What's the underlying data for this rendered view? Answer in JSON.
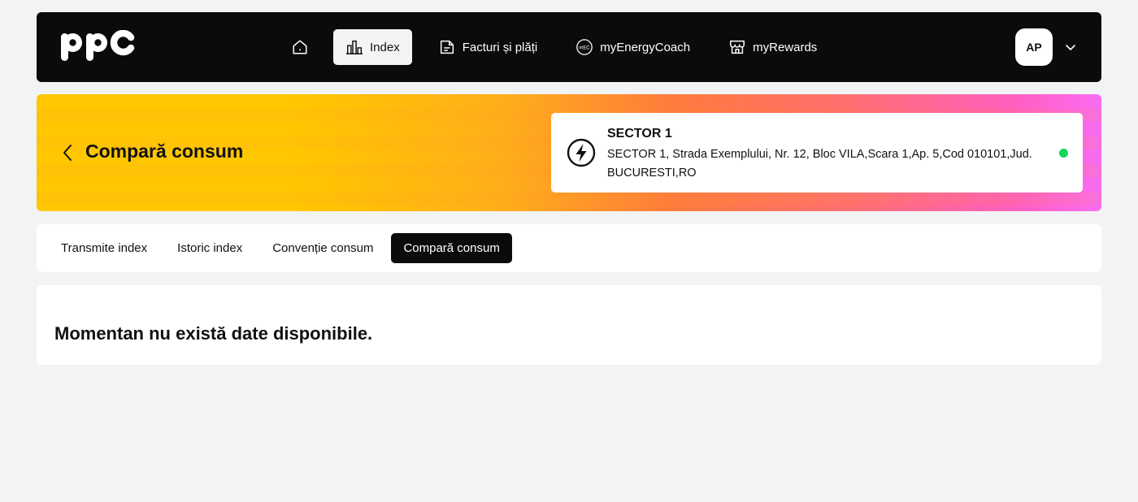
{
  "brand": {
    "logo_text": "ppc"
  },
  "nav": {
    "home_icon": "home-icon",
    "items": [
      {
        "label": "Index",
        "icon": "bar-chart-icon",
        "active": true
      },
      {
        "label": "Facturi și plăți",
        "icon": "invoice-icon",
        "active": false
      },
      {
        "label": "myEnergyCoach",
        "icon": "energy-coach-icon",
        "icon_text": "mEC",
        "active": false
      },
      {
        "label": "myRewards",
        "icon": "rewards-store-icon",
        "active": false
      }
    ]
  },
  "user": {
    "initials": "AP",
    "menu_icon": "chevron-down-icon"
  },
  "hero": {
    "title": "Compară consum",
    "back_icon": "chevron-left-icon",
    "place": {
      "name": "SECTOR 1",
      "address": "SECTOR 1, Strada Exemplului, Nr. 12, Bloc VILA,Scara 1,Ap. 5,Cod 010101,Jud. BUCURESTI,RO",
      "icon": "lightning-bolt-icon",
      "status_color": "#17d65b"
    }
  },
  "tabs": [
    {
      "label": "Transmite index",
      "active": false
    },
    {
      "label": "Istoric index",
      "active": false
    },
    {
      "label": "Convenție consum",
      "active": false
    },
    {
      "label": "Compară consum",
      "active": true
    }
  ],
  "content": {
    "empty_message": "Momentan nu există date disponibile."
  },
  "colors": {
    "header_bg": "#0b0b0b",
    "page_bg": "#f2f3f5",
    "brand_yellow": "#ffc700",
    "brand_pink": "#fb6cf2",
    "status_green": "#17d65b"
  }
}
